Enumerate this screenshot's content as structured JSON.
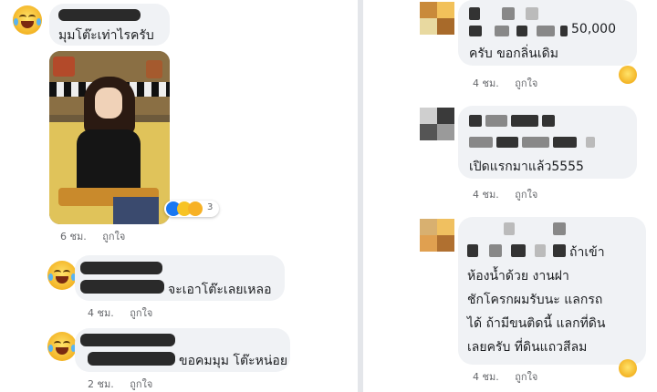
{
  "left": {
    "comments": [
      {
        "text": "มุมโต๊ะเท่าไรครับ",
        "time": "6 ชม.",
        "like": "ถูกใจ",
        "reaction_count": "3"
      },
      {
        "text": "จะเอาโต๊ะเลยเหลอ",
        "time": "4 ชม.",
        "like": "ถูกใจ"
      },
      {
        "text": "ขอคมมุม โต๊ะหน่อย",
        "time": "2 ชม.",
        "like": "ถูกใจ"
      }
    ]
  },
  "right": {
    "comments": [
      {
        "line1": "50,000",
        "line2": "ครับ ขอกลิ่นเดิม",
        "time": "4 ชม.",
        "like": "ถูกใจ"
      },
      {
        "line1": "เปิดแรกมาแล้ว5555",
        "time": "4 ชม.",
        "like": "ถูกใจ"
      },
      {
        "line1": "ถ้าเข้า",
        "line2": "ห้องน้ำด้วย งานฝา",
        "line3": "ชักโครกผมรับนะ แลกรถ",
        "line4": "ได้ ถ้ามีขนติดนี้ แลกที่ดิน",
        "line5": "เลยครับ ที่ดินแถวสีลม",
        "time": "4 ชม.",
        "like": "ถูกใจ"
      }
    ]
  },
  "icons": {
    "laugh": "laughing-crying-emoji-icon",
    "like": "like-reaction-icon",
    "haha": "haha-reaction-icon",
    "wow": "wow-reaction-icon"
  },
  "colors": {
    "bubble": "#f0f2f5",
    "meta_text": "#65676b",
    "like_blue": "#1877f2",
    "divider": "#e4e6ea"
  }
}
